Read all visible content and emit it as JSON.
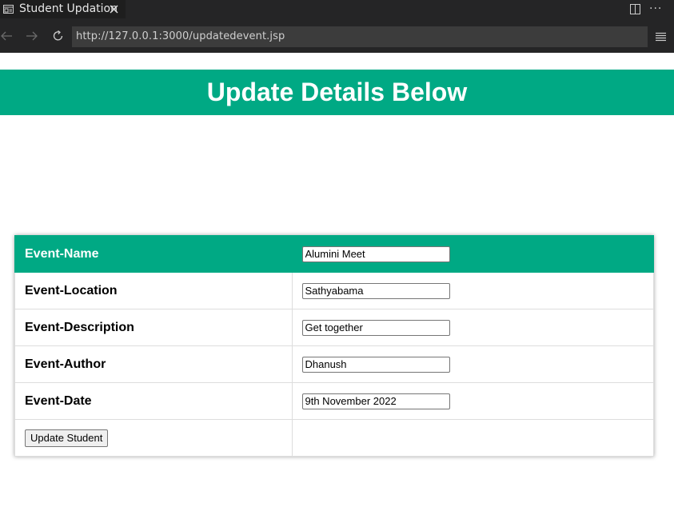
{
  "browser": {
    "tab_title": "Student Updation",
    "url": "http://127.0.0.1:3000/updatedevent.jsp"
  },
  "page": {
    "heading": "Update Details Below",
    "colors": {
      "accent": "#00a984"
    },
    "form": {
      "rows": [
        {
          "label": "Event-Name",
          "value": "Alumini Meet"
        },
        {
          "label": "Event-Location",
          "value": "Sathyabama"
        },
        {
          "label": "Event-Description",
          "value": "Get together"
        },
        {
          "label": "Event-Author",
          "value": "Dhanush"
        },
        {
          "label": "Event-Date",
          "value": "9th November 2022"
        }
      ],
      "submit_label": "Update Student"
    }
  }
}
